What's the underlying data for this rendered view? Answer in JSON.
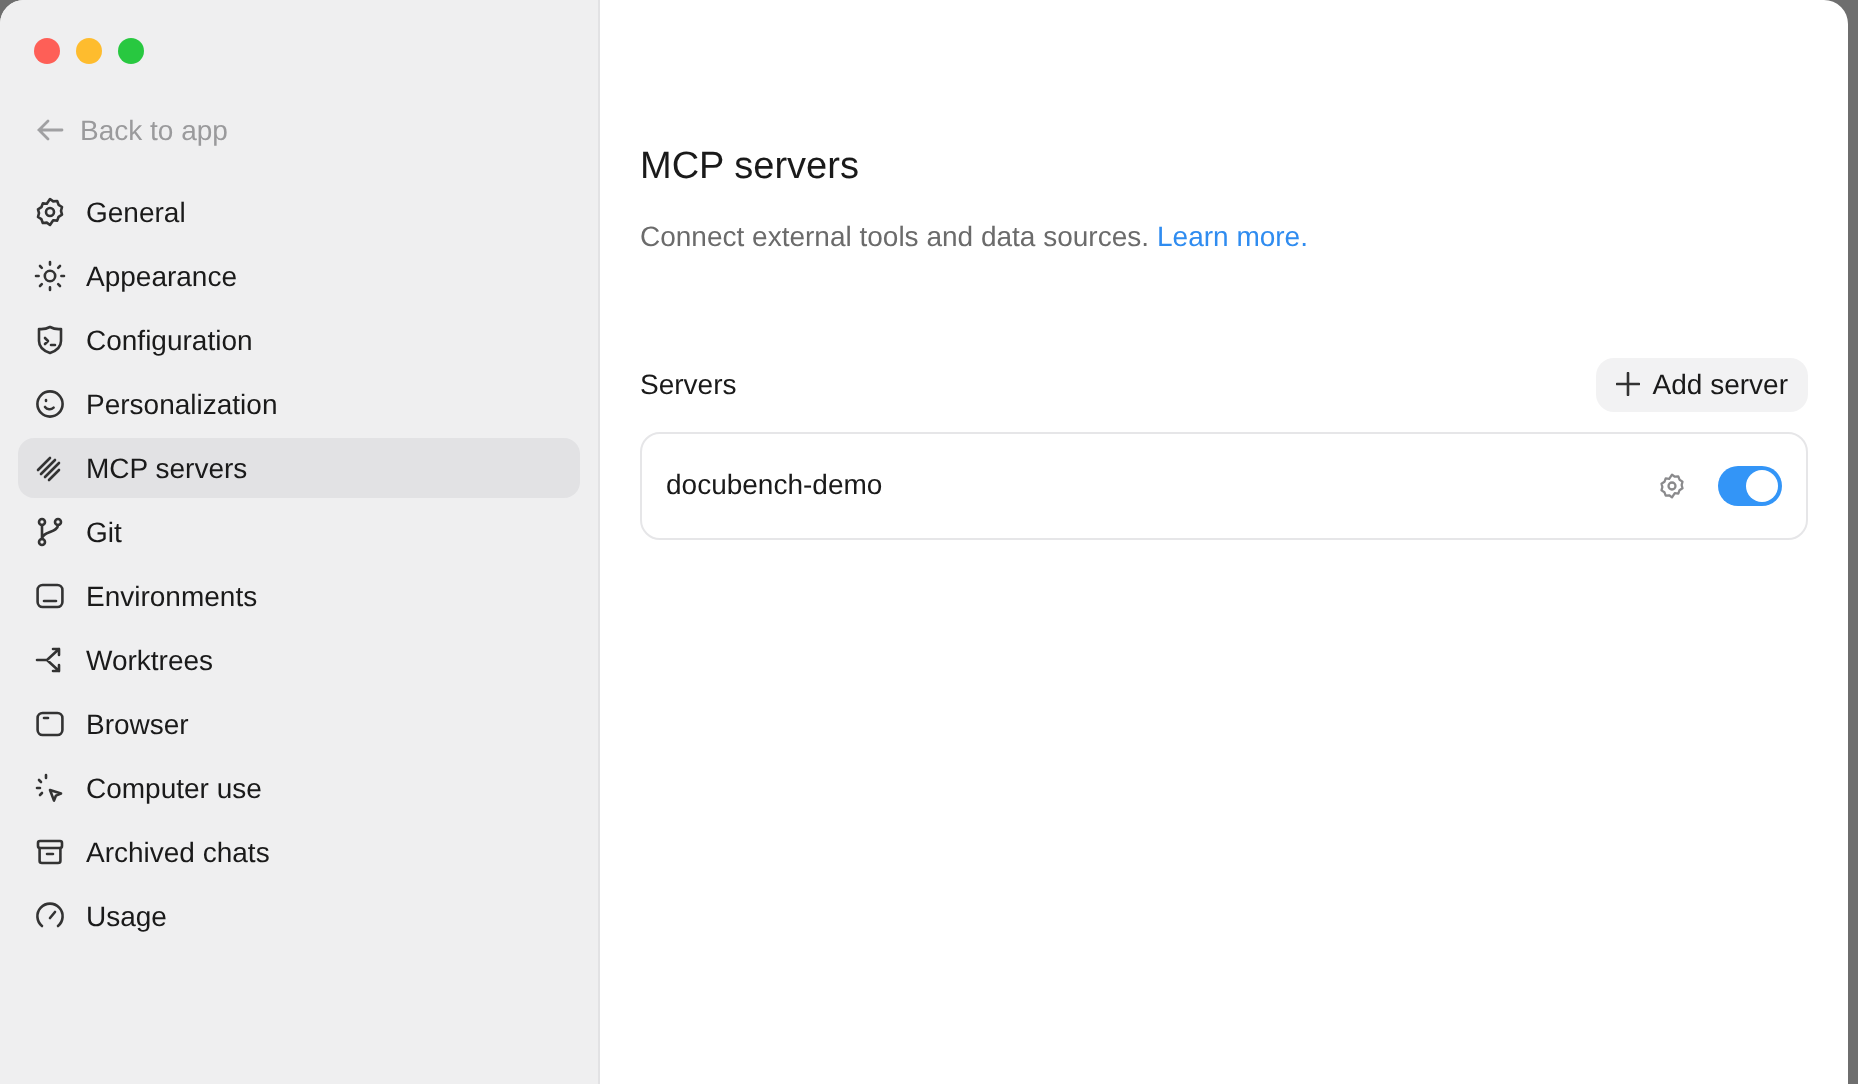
{
  "back_link": {
    "label": "Back to app"
  },
  "sidebar": {
    "items": [
      {
        "label": "General",
        "selected": false
      },
      {
        "label": "Appearance",
        "selected": false
      },
      {
        "label": "Configuration",
        "selected": false
      },
      {
        "label": "Personalization",
        "selected": false
      },
      {
        "label": "MCP servers",
        "selected": true
      },
      {
        "label": "Git",
        "selected": false
      },
      {
        "label": "Environments",
        "selected": false
      },
      {
        "label": "Worktrees",
        "selected": false
      },
      {
        "label": "Browser",
        "selected": false
      },
      {
        "label": "Computer use",
        "selected": false
      },
      {
        "label": "Archived chats",
        "selected": false
      },
      {
        "label": "Usage",
        "selected": false
      }
    ]
  },
  "page": {
    "title": "MCP servers",
    "description": "Connect external tools and data sources.",
    "learn_more": "Learn more."
  },
  "servers": {
    "heading": "Servers",
    "add_button": "Add server",
    "items": [
      {
        "name": "docubench-demo",
        "on": true
      }
    ]
  }
}
